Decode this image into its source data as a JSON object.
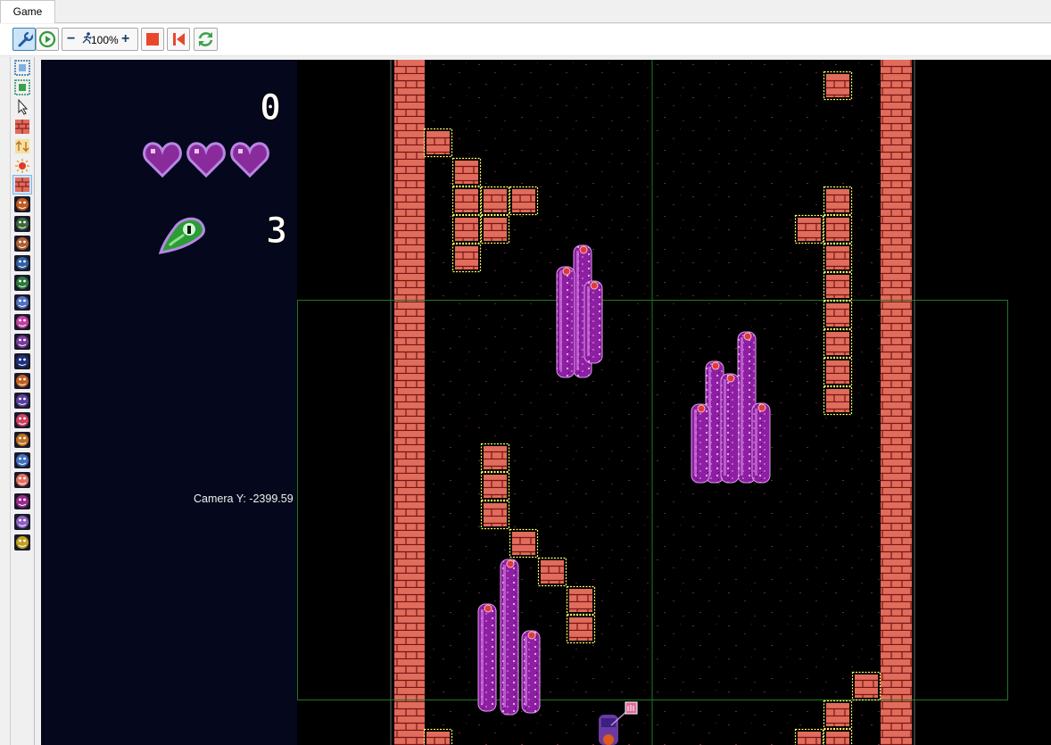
{
  "window": {
    "tab_label": "Game"
  },
  "toolbar": {
    "zoom_level": "100%",
    "buttons": [
      "edit-tool",
      "play",
      "zoom-out",
      "zoom-in",
      "stop",
      "restart",
      "refresh"
    ]
  },
  "palette": {
    "items": [
      "select-region-icon",
      "fit-view-icon",
      "pointer-icon",
      "brick-icon",
      "arrows-icon",
      "spark-icon",
      "tile-icon",
      "skull-icon",
      "mantis-icon",
      "owl-icon",
      "ghost-icon",
      "turtle-icon",
      "crystal-icon",
      "bug-icon",
      "wizard-icon",
      "orb-icon",
      "fox-icon",
      "dragon-icon",
      "crab-icon",
      "squirrel-icon",
      "sword-icon",
      "octopus-icon",
      "shell-icon",
      "jelly-icon",
      "mushroom-icon"
    ],
    "selected": "tile-icon"
  },
  "hud": {
    "score": "0",
    "lives": 3,
    "gem_count": "3",
    "camera_label": "Camera Y: -2399.59"
  },
  "colors": {
    "hud_background": "#05081c",
    "brick": "#e06c5c",
    "mortar": "#7a1414",
    "tile_outline": "#ffff66",
    "heart": "#8a2b9c",
    "heart_border": "#b787e4",
    "gem": "#2a9d36",
    "pillar": "#8d1fa2",
    "guide_line": "#1f7a1f"
  }
}
